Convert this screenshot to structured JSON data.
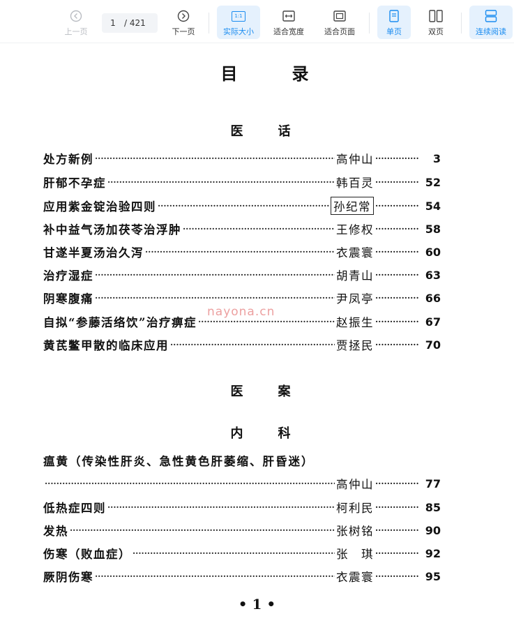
{
  "toolbar": {
    "prev_label": "上一页",
    "current_page": "1",
    "total_pages": "/ 421",
    "next_label": "下一页",
    "actual_size_label": "实际大小",
    "actual_size_icon_text": "1:1",
    "fit_width_label": "适合宽度",
    "fit_page_label": "适合页面",
    "single_label": "单页",
    "double_label": "双页",
    "continuous_label": "连续阅读",
    "accent": "#1a8cf0"
  },
  "document": {
    "title": "目录",
    "section1": "医话",
    "entries1": [
      {
        "title": "处方新例",
        "author": "高仲山",
        "page": "3"
      },
      {
        "title": "肝郁不孕症",
        "author": "韩百灵",
        "page": "52"
      },
      {
        "title": "应用紫金锭治验四则",
        "author": "孙纪常",
        "page": "54"
      },
      {
        "title": "补中益气汤加茯苓治浮肿",
        "author": "王修权",
        "page": "58"
      },
      {
        "title": "甘遂半夏汤治久泻",
        "author": "衣震寰",
        "page": "60"
      },
      {
        "title": "治疗湿症",
        "author": "胡青山",
        "page": "63"
      },
      {
        "title": "阴寒腹痛",
        "author": "尹凤亭",
        "page": "66"
      },
      {
        "title": "自拟“参藤活络饮”治疗痹症",
        "author": "赵振生",
        "page": "67"
      },
      {
        "title": "黄芪鳖甲散的临床应用",
        "author": "贾拯民",
        "page": "70"
      }
    ],
    "section2": "医案",
    "subsection": "内科",
    "long_title": "瘟黄（传染性肝炎、急性黄色肝萎缩、肝昏迷）",
    "entries2": [
      {
        "title": "",
        "author": "高仲山",
        "page": "77"
      },
      {
        "title": "低热症四则",
        "author": "柯利民",
        "page": "85"
      },
      {
        "title": "发热",
        "author": "张树铭",
        "page": "90"
      },
      {
        "title": "伤寒（败血症）",
        "author": "张　琪",
        "page": "92"
      },
      {
        "title": "厥阴伤寒",
        "author": "衣震寰",
        "page": "95"
      }
    ],
    "watermark": "nayona.cn",
    "footer_page": "• 1 •"
  }
}
